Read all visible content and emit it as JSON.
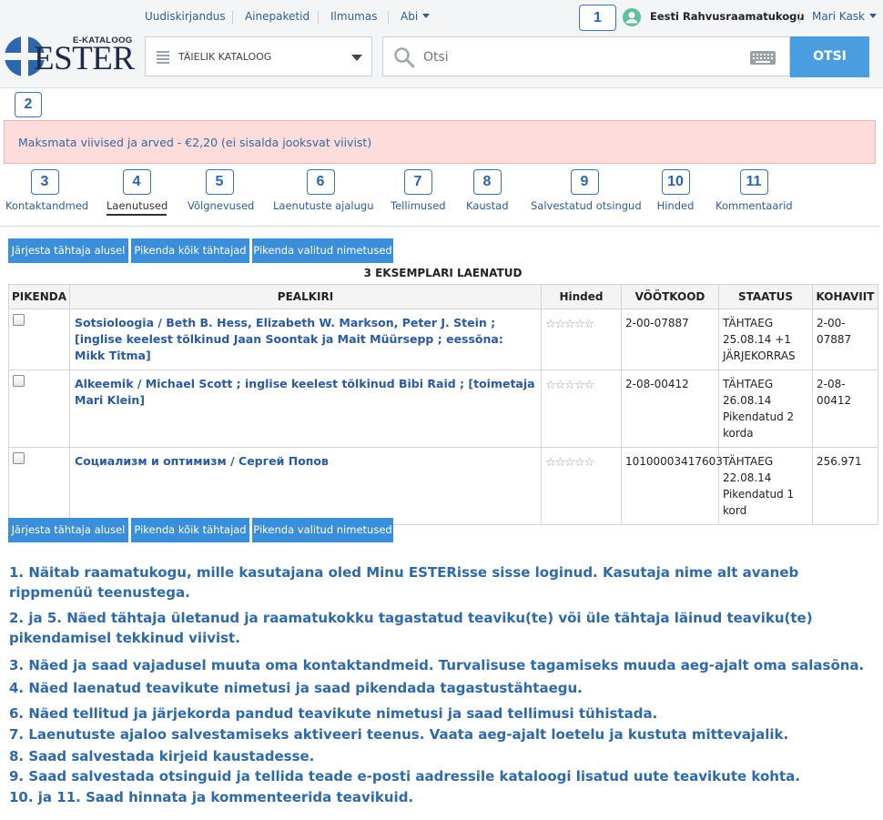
{
  "topnav": {
    "links": [
      "Uudiskirjandus",
      "Ainepaketid",
      "Ilmumas",
      "Abi"
    ],
    "library": "Eesti Rahvusraamatukogu",
    "user": "Mari Kask"
  },
  "logo": {
    "small": "E-KATALOOG",
    "big": "ESTER"
  },
  "search": {
    "catalog": "TÄIELIK KATALOOG",
    "placeholder": "Otsi",
    "button": "OTSI"
  },
  "markers": [
    "1",
    "2",
    "3",
    "4",
    "5",
    "6",
    "7",
    "8",
    "9",
    "10",
    "11"
  ],
  "alert": "Maksmata viivised ja arved - €2,20 (ei sisalda jooksvat viivist)",
  "tabs": [
    "Kontaktandmed",
    "Laenutused",
    "Võlgnevused",
    "Laenutuste ajalugu",
    "Tellimused",
    "Kaustad",
    "Salvestatud otsingud",
    "Hinded",
    "Kommentaarid"
  ],
  "actions": [
    "Järjesta tähtaja alusel",
    "Pikenda kõik tähtajad",
    "Pikenda valitud nimetused"
  ],
  "loans": {
    "count_label": "3 EKSEMPLARI LAENATUD",
    "columns": [
      "PIKENDA",
      "PEALKIRI",
      "Hinded",
      "VÖÖTKOOD",
      "STAATUS",
      "KOHAVIIT"
    ],
    "rating_display": "☆☆☆☆☆",
    "rows": [
      {
        "title": "Sotsioloogia / Beth B. Hess, Elizabeth W. Markson, Peter J. Stein ; [inglise keelest tõlkinud Jaan Soontak ja Mait Müürsepp ; eessõna: Mikk Titma]",
        "barcode": "2-00-07887",
        "status": "TÄHTAEG 25.08.14 +1 JÄRJEKORRAS",
        "callno": "2-00-07887"
      },
      {
        "title": "Alkeemik / Michael Scott ; inglise keelest tõlkinud Bibi Raid ; [toimetaja Mari Klein]",
        "barcode": "2-08-00412",
        "status": "TÄHTAEG 26.08.14 Pikendatud 2 korda",
        "callno": "2-08-00412"
      },
      {
        "title": "Социализм и оптимизм / Сергей Попов",
        "barcode": "10100003417603",
        "status": "TÄHTAEG 22.08.14 Pikendatud 1 kord",
        "callno": "256.971"
      }
    ]
  },
  "notes": [
    "1. Näitab raamatukogu, mille kasutajana oled Minu ESTERisse sisse loginud. Kasutaja nime alt avaneb rippmenüü teenustega.",
    "2. ja 5. Näed tähtaja ületanud ja raamatukokku tagastatud teaviku(te) või üle tähtaja läinud teaviku(te) pikendamisel tekkinud viivist.",
    "3. Näed ja saad vajadusel muuta oma kontaktandmeid. Turvalisuse tagamiseks muuda aeg-ajalt oma salasõna.",
    "4. Näed laenatud teavikute nimetusi ja saad pikendada tagastustähtaegu.",
    "6. Näed tellitud ja järjekorda pandud teavikute nimetusi ja saad tellimusi tühistada.",
    "7. Laenutuste ajaloo salvestamiseks aktiveeri teenus. Vaata aeg-ajalt loetelu ja kustuta mittevajalik.",
    "8. Saad salvestada kirjeid kaustadesse.",
    "9. Saad salvestada otsinguid ja tellida teade e-posti aadressile kataloogi lisatud uute teavikute kohta.",
    "10. ja 11. Saad hinnata ja kommenteerida teavikuid."
  ]
}
